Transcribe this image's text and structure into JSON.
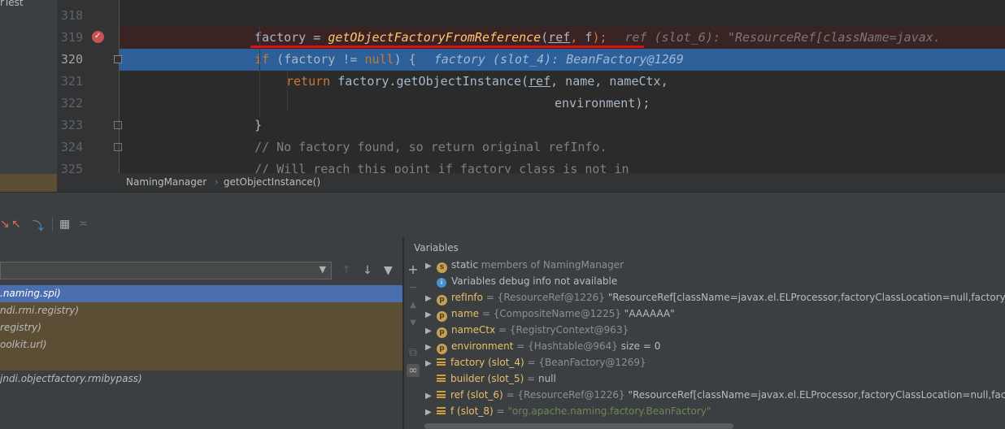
{
  "project": {
    "title": "rTest"
  },
  "gutter": {
    "lines": [
      "318",
      "319",
      "320",
      "321",
      "322",
      "323",
      "324",
      "325"
    ]
  },
  "code": {
    "l319": {
      "lhs": "factory",
      "eq": " = ",
      "method": "getObjectFactoryFromReference",
      "p1": "(",
      "ref": "ref",
      "comma": ", ",
      "f": "f",
      "close": ");",
      "hint": "ref (slot_6): \"ResourceRef[className=javax."
    },
    "l320": {
      "kw": "if",
      "cond": " (factory != ",
      "null": "null",
      "brace": ") {",
      "hint": "factory (slot_4): BeanFactory@1269"
    },
    "l321": {
      "kw": "return",
      "a": " factory.getObjectInstance(",
      "ref": "ref",
      "b": ", name, nameCtx,"
    },
    "l322": {
      "text": "environment);"
    },
    "l323": {
      "text": "}"
    },
    "l324": {
      "text": "// No factory found, so return original refInfo."
    },
    "l325": {
      "text": "// Will reach this point if factory class is not in"
    }
  },
  "breadcrumb": {
    "class": "NamingManager",
    "sep": "›",
    "method": "getObjectInstance()"
  },
  "frames": {
    "items": [
      {
        "label": ".naming.spi)"
      },
      {
        "label": "ndi.rmi.registry)"
      },
      {
        "label": "registry)"
      },
      {
        "label": "oolkit.url)"
      },
      {
        "label": ""
      },
      {
        "label": "jndi.objectfactory.rmibypass)"
      }
    ]
  },
  "variables": {
    "header": "Variables",
    "rows": [
      {
        "badge": "s",
        "name": "static",
        "type": " members of NamingManager",
        "value": ""
      },
      {
        "badge": "i",
        "name": "Variables debug info not available",
        "type": "",
        "value": ""
      },
      {
        "badge": "p",
        "name": "refInfo",
        "type": " = {ResourceRef@1226} ",
        "value": "\"ResourceRef[className=javax.el.ELProcessor,factoryClassLocation=null,factoryClass"
      },
      {
        "badge": "p",
        "name": "name",
        "type": " = {CompositeName@1225} ",
        "value": "\"AAAAAA\""
      },
      {
        "badge": "p",
        "name": "nameCtx",
        "type": " = {RegistryContext@963}",
        "value": ""
      },
      {
        "badge": "p",
        "name": "environment",
        "type": " = {Hashtable@964} ",
        "value": " size = 0"
      },
      {
        "badge": "l",
        "name": "factory (slot_4)",
        "type": " = {BeanFactory@1269}",
        "value": ""
      },
      {
        "badge": "l",
        "name": "builder (slot_5)",
        "type": " = ",
        "value": "null"
      },
      {
        "badge": "l",
        "name": "ref (slot_6)",
        "type": " = {ResourceRef@1226} ",
        "value": "\"ResourceRef[className=javax.el.ELProcessor,factoryClassLocation=null,factoryC"
      },
      {
        "badge": "l",
        "name": "f (slot_8)",
        "type": " = ",
        "value": "\"org.apache.naming.factory.BeanFactory\""
      }
    ]
  },
  "colors": {
    "accent_exec": "#2d6099",
    "annotation_red": "#e01010",
    "keyword": "#cc7832",
    "method": "#ffc66d"
  }
}
